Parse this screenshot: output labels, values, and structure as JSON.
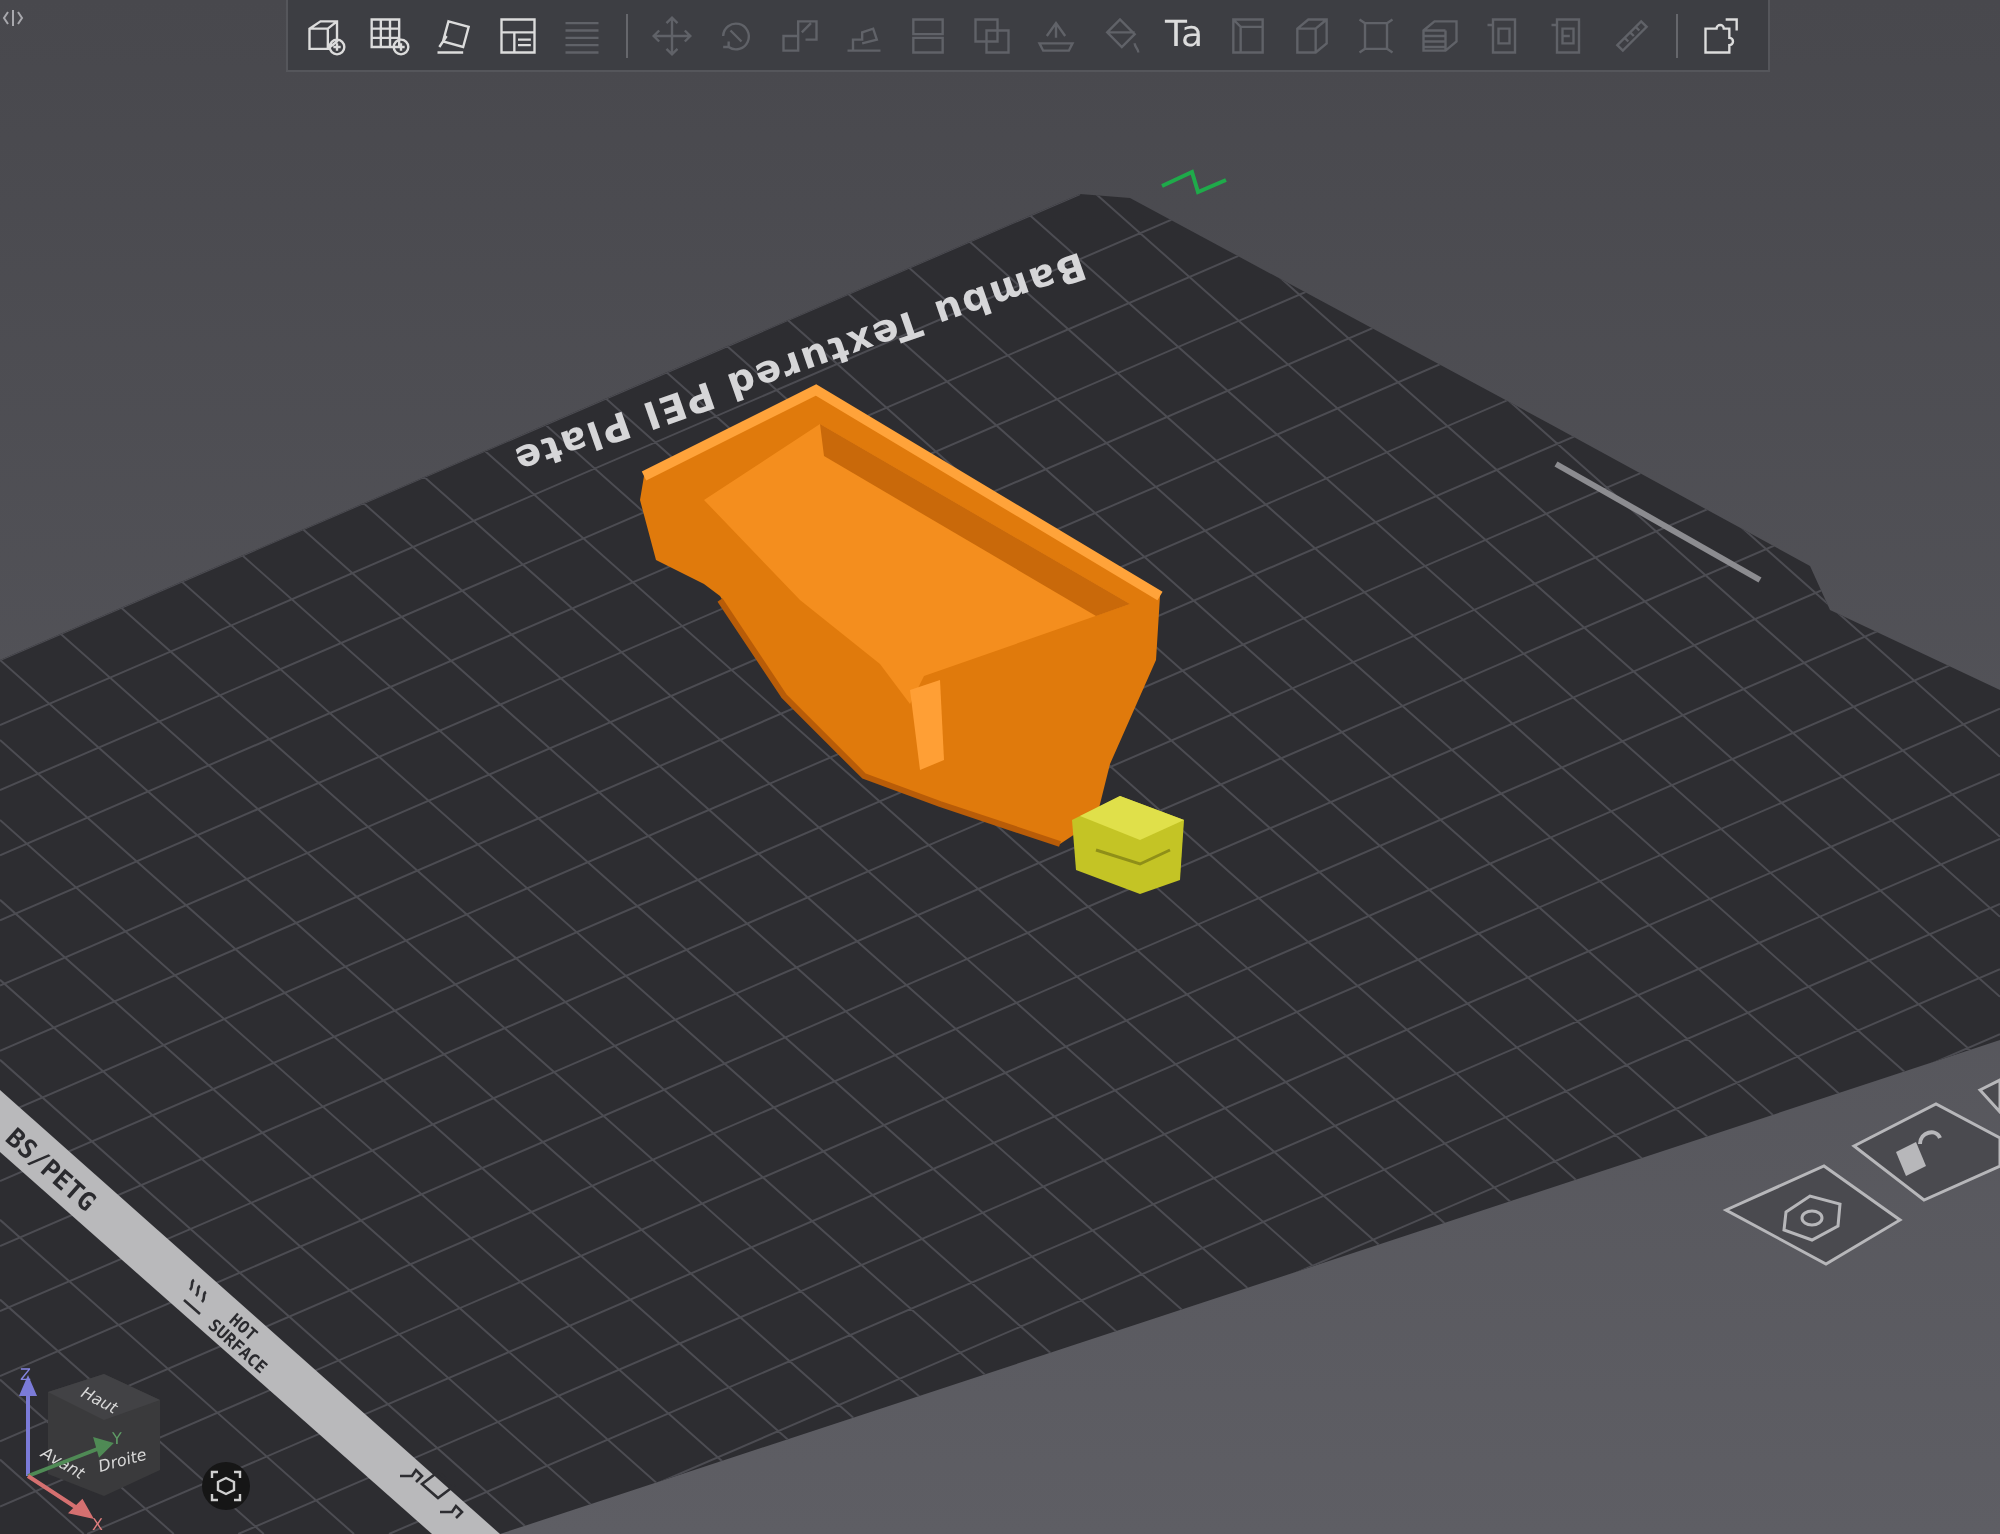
{
  "toolbar": {
    "tools": [
      {
        "enabled": true
      },
      {
        "enabled": true
      },
      {
        "enabled": true
      },
      {
        "enabled": true
      },
      {
        "enabled": false
      },
      {
        "enabled": false
      },
      {
        "enabled": false
      },
      {
        "enabled": false
      },
      {
        "enabled": false
      },
      {
        "enabled": false
      },
      {
        "enabled": false
      },
      {
        "enabled": false
      },
      {
        "enabled": false
      },
      {
        "enabled": true,
        "glyph": "Ta"
      },
      {
        "enabled": false
      },
      {
        "enabled": false
      },
      {
        "enabled": false
      },
      {
        "enabled": false
      },
      {
        "enabled": false
      },
      {
        "enabled": false
      },
      {
        "enabled": false
      },
      {
        "enabled": true
      }
    ]
  },
  "plate": {
    "name": "Bambu Textured PEI Plate",
    "filament_label": "BS/PETG",
    "warning": [
      "HOT",
      "SURFACE"
    ]
  },
  "view_cube": {
    "faces": [
      "Haut",
      "Avant",
      "Droite"
    ],
    "axes": [
      "Z",
      "Y",
      "X"
    ]
  }
}
